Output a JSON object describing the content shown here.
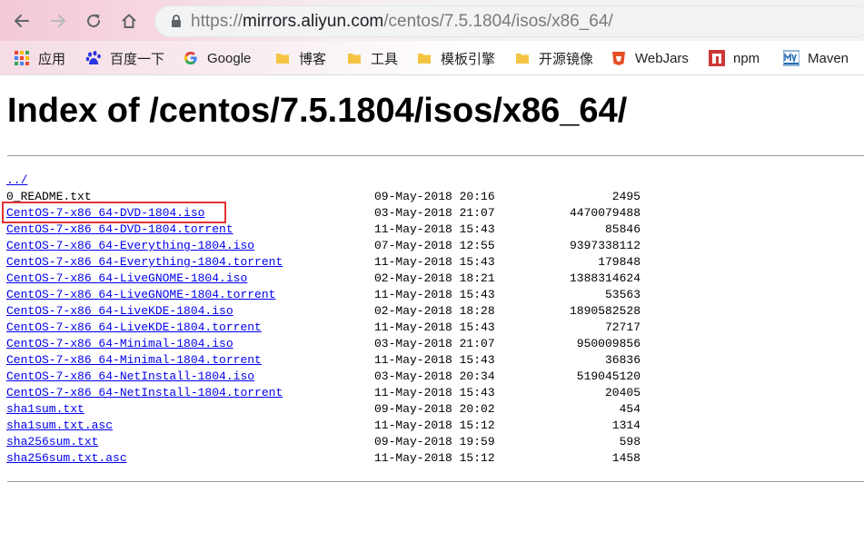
{
  "browser": {
    "url_scheme": "https://",
    "url_host": "mirrors.aliyun.com",
    "url_path": "/centos/7.5.1804/isos/x86_64/"
  },
  "bookmarks": [
    {
      "label": "应用",
      "icon": "apps-grid-icon"
    },
    {
      "label": "百度一下",
      "icon": "baidu-paw-icon"
    },
    {
      "label": "Google",
      "icon": "google-g-icon"
    },
    {
      "label": "博客",
      "icon": "folder-icon"
    },
    {
      "label": "工具",
      "icon": "folder-icon"
    },
    {
      "label": "模板引擎",
      "icon": "folder-icon"
    },
    {
      "label": "开源镜像",
      "icon": "folder-icon"
    },
    {
      "label": "WebJars",
      "icon": "webjars-icon"
    },
    {
      "label": "npm",
      "icon": "npm-icon"
    },
    {
      "label": "Maven",
      "icon": "maven-icon"
    }
  ],
  "page": {
    "title": "Index of /centos/7.5.1804/isos/x86_64/",
    "parent_link": "../"
  },
  "files": [
    {
      "name": "0_README.txt",
      "link": false,
      "date": "09-May-2018 20:16",
      "size": "2495"
    },
    {
      "name": "CentOS-7-x86_64-DVD-1804.iso",
      "link": true,
      "date": "03-May-2018 21:07",
      "size": "4470079488"
    },
    {
      "name": "CentOS-7-x86_64-DVD-1804.torrent",
      "link": true,
      "date": "11-May-2018 15:43",
      "size": "85846"
    },
    {
      "name": "CentOS-7-x86_64-Everything-1804.iso",
      "link": true,
      "date": "07-May-2018 12:55",
      "size": "9397338112"
    },
    {
      "name": "CentOS-7-x86_64-Everything-1804.torrent",
      "link": true,
      "date": "11-May-2018 15:43",
      "size": "179848"
    },
    {
      "name": "CentOS-7-x86_64-LiveGNOME-1804.iso",
      "link": true,
      "date": "02-May-2018 18:21",
      "size": "1388314624"
    },
    {
      "name": "CentOS-7-x86_64-LiveGNOME-1804.torrent",
      "link": true,
      "date": "11-May-2018 15:43",
      "size": "53563"
    },
    {
      "name": "CentOS-7-x86_64-LiveKDE-1804.iso",
      "link": true,
      "date": "02-May-2018 18:28",
      "size": "1890582528"
    },
    {
      "name": "CentOS-7-x86_64-LiveKDE-1804.torrent",
      "link": true,
      "date": "11-May-2018 15:43",
      "size": "72717"
    },
    {
      "name": "CentOS-7-x86_64-Minimal-1804.iso",
      "link": true,
      "date": "03-May-2018 21:07",
      "size": "950009856"
    },
    {
      "name": "CentOS-7-x86_64-Minimal-1804.torrent",
      "link": true,
      "date": "11-May-2018 15:43",
      "size": "36836"
    },
    {
      "name": "CentOS-7-x86_64-NetInstall-1804.iso",
      "link": true,
      "date": "03-May-2018 20:34",
      "size": "519045120"
    },
    {
      "name": "CentOS-7-x86_64-NetInstall-1804.torrent",
      "link": true,
      "date": "11-May-2018 15:43",
      "size": "20405"
    },
    {
      "name": "sha1sum.txt",
      "link": true,
      "date": "09-May-2018 20:02",
      "size": "454"
    },
    {
      "name": "sha1sum.txt.asc",
      "link": true,
      "date": "11-May-2018 15:12",
      "size": "1314"
    },
    {
      "name": "sha256sum.txt",
      "link": true,
      "date": "09-May-2018 19:59",
      "size": "598"
    },
    {
      "name": "sha256sum.txt.asc",
      "link": true,
      "date": "11-May-2018 15:12",
      "size": "1458"
    }
  ],
  "colors": {
    "link": "#0000ee",
    "highlight_border": "#e23232",
    "nav_icon": "#5f6368"
  }
}
